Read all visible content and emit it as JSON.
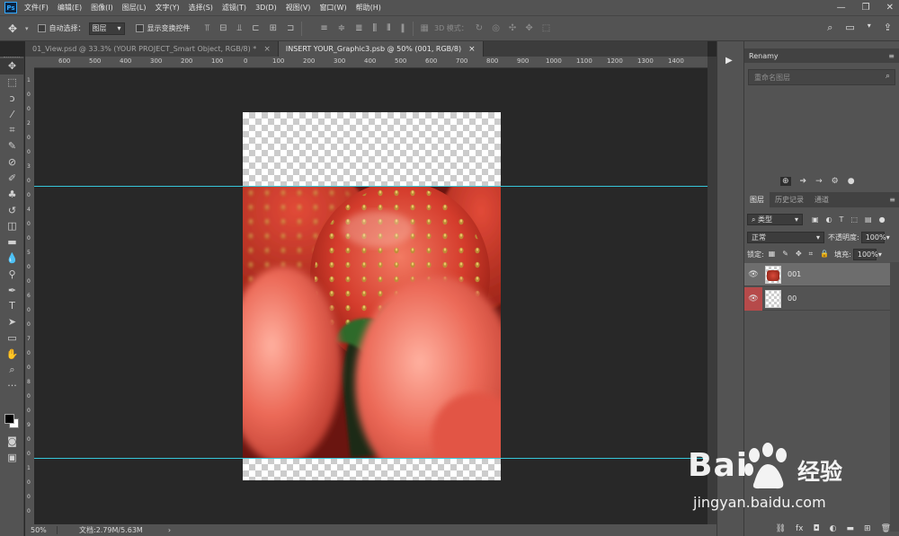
{
  "app": {
    "logo": "Ps"
  },
  "menu": [
    "文件(F)",
    "编辑(E)",
    "图像(I)",
    "图层(L)",
    "文字(Y)",
    "选择(S)",
    "滤镜(T)",
    "3D(D)",
    "视图(V)",
    "窗口(W)",
    "帮助(H)"
  ],
  "window_controls": {
    "minimize": "—",
    "restore": "❐",
    "close": "✕"
  },
  "options": {
    "auto_select_label": "自动选择：",
    "auto_select_value": "图层",
    "show_transform_label": "显示变换控件",
    "mode_3d_label": "3D 模式："
  },
  "tabs": [
    {
      "label": "01_View.psd @ 33.3% (YOUR PROJECT_Smart Object, RGB/8) *",
      "close": "×"
    },
    {
      "label": "INSERT YOUR_Graphic3.psb @ 50% (001, RGB/8)",
      "close": "×"
    }
  ],
  "ruler_h_labels": [
    "600",
    "500",
    "400",
    "300",
    "200",
    "100",
    "0",
    "100",
    "200",
    "300",
    "400",
    "500",
    "600",
    "700",
    "800",
    "900",
    "1000",
    "1100",
    "1200",
    "1300",
    "1400"
  ],
  "status": {
    "zoom": "50%",
    "doc_info": "文档:2.79M/5.63M",
    "arrow": "›"
  },
  "renamy": {
    "title": "Renamy",
    "search_placeholder": "重命名图层"
  },
  "layers_panel": {
    "tabs": [
      "图层",
      "历史记录",
      "通道"
    ],
    "filter_kind": "类型",
    "blend_mode": "正常",
    "opacity_label": "不透明度:",
    "opacity_value": "100%",
    "lock_label": "锁定:",
    "fill_label": "填充:",
    "fill_value": "100%",
    "layers": [
      {
        "name": "001",
        "selected": true,
        "visible": true
      },
      {
        "name": "00",
        "selected": false,
        "visible": true
      }
    ]
  },
  "icons": {
    "move": "move-icon",
    "marquee": "marquee-icon",
    "lasso": "lasso-icon",
    "magic_wand": "magic-wand-icon",
    "crop": "crop-icon",
    "eyedropper": "eyedropper-icon",
    "healing": "healing-brush-icon",
    "brush": "brush-icon",
    "stamp": "clone-stamp-icon",
    "history_brush": "history-brush-icon",
    "eraser": "eraser-icon",
    "gradient": "gradient-icon",
    "blur": "blur-icon",
    "dodge": "dodge-icon",
    "pen": "pen-icon",
    "type": "type-icon",
    "path_select": "path-selection-icon",
    "rectangle": "rectangle-icon",
    "hand": "hand-icon",
    "zoom": "zoom-icon",
    "more": "more-tools-icon"
  },
  "watermark": {
    "brand": "Bai  ",
    "cn": "经验",
    "url": "jingyan.baidu.com"
  }
}
